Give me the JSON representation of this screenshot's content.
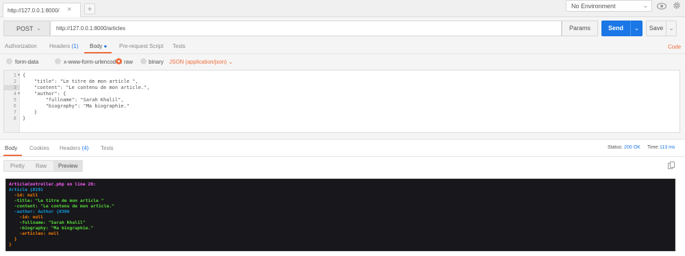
{
  "top_bar": {
    "tab_title": "http://127.0.0.1:8000/",
    "tab_close": "×",
    "add_tab": "+",
    "environment": "No Environment",
    "env_arrow": "⌄"
  },
  "request": {
    "method": "POST",
    "method_arrow": "⌄",
    "url": "http://127.0.0.1:8000/articles",
    "params_label": "Params",
    "send_label": "Send",
    "send_arrow": "⌄",
    "save_label": "Save",
    "save_arrow": "⌄"
  },
  "request_tabs": {
    "authorization": "Authorization",
    "headers": "Headers",
    "headers_count": "(1)",
    "body": "Body",
    "prerequest": "Pre-request Script",
    "tests": "Tests",
    "code": "Code"
  },
  "body_options": {
    "form_data": "form-data",
    "urlencoded": "x-www-form-urlencoded",
    "raw": "raw",
    "binary": "binary",
    "content_type": "JSON (application/json)",
    "selected": "raw"
  },
  "editor": {
    "line_numbers": [
      "1",
      "2",
      "3",
      "4",
      "5",
      "6",
      "7",
      "8"
    ],
    "lines": [
      "{",
      "    \"title\": \"Le titre de mon article \",",
      "    \"content\": \"Le contenu de mon article.\",",
      "    \"author\": {",
      "        \"fullname\": \"Sarah Khalil\",",
      "        \"biography\": \"Ma biographie.\"",
      "    }",
      "}"
    ],
    "active_line": 3
  },
  "response_tabs": {
    "body": "Body",
    "cookies": "Cookies",
    "headers": "Headers",
    "headers_count": "(4)",
    "tests": "Tests",
    "status_label": "Status:",
    "status_value": "200 OK",
    "time_label": "Time:",
    "time_value": "113 ms"
  },
  "view_modes": {
    "pretty": "Pretty",
    "raw": "Raw",
    "preview": "Preview",
    "active": "Preview"
  },
  "dump": {
    "file_line": "ArticleController.php on line 20:",
    "class_line": "Article {#291",
    "id_line": "  -id: null",
    "title_line": "  -title: \"Le titre de mon article \"",
    "content_line": "  -content: \"Le contenu de mon article.\"",
    "author_line": "  -author: Author {#306",
    "author_id": "    -id: null",
    "fullname": "    -fullname: \"Sarah Khalil\"",
    "biography": "    -biography: \"Ma biographie.\"",
    "articles": "    -articles: null",
    "close_inner": "  }",
    "close_outer": "}"
  }
}
